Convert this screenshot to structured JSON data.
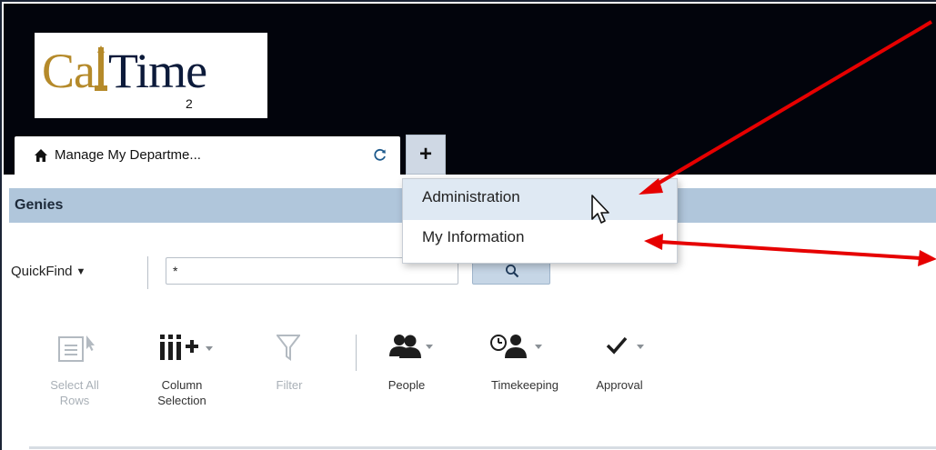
{
  "logo": {
    "main": "Ca",
    "main2": "Time",
    "sub": "2"
  },
  "tabs": [
    {
      "label": "Manage My Departme...",
      "icon": "home-icon",
      "refresh_icon": "refresh-icon"
    }
  ],
  "add_tab": {
    "label": "+"
  },
  "dropdown": {
    "items": [
      {
        "label": "Administration"
      },
      {
        "label": "My Information"
      }
    ]
  },
  "genies": {
    "title": "Genies"
  },
  "quickfind": {
    "label": "QuickFind",
    "value": "*",
    "search_icon": "search-icon"
  },
  "toolbar": {
    "items": [
      {
        "label": "Select All\nRows",
        "icon": "select-all-rows-icon",
        "enabled": false
      },
      {
        "label": "Column\nSelection",
        "icon": "column-selection-icon",
        "enabled": true
      },
      {
        "label": "Filter",
        "icon": "filter-icon",
        "enabled": false
      },
      {
        "label": "People",
        "icon": "people-icon",
        "enabled": true
      },
      {
        "label": "Timekeeping",
        "icon": "timekeeping-icon",
        "enabled": true
      },
      {
        "label": "Approval",
        "icon": "approval-icon",
        "enabled": true
      }
    ]
  },
  "colors": {
    "header_bg": "#02040c",
    "genies_bar": "#b0c6db",
    "dropdown_hover": "#dfe9f3",
    "annotation_arrow": "#e60000"
  }
}
